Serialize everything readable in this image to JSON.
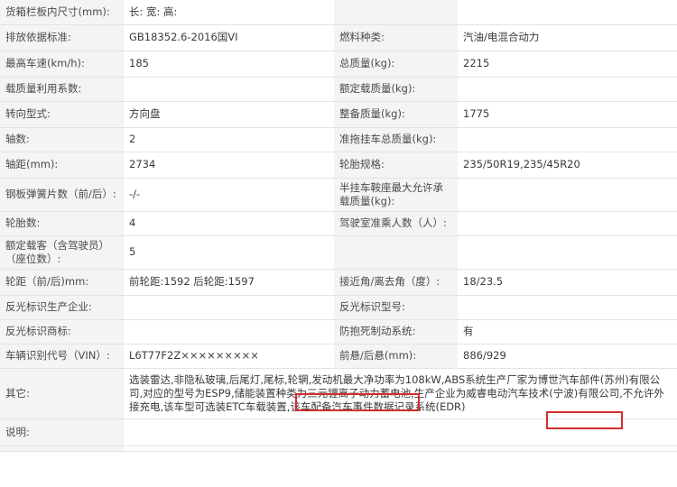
{
  "rows": [
    {
      "l1": "货箱栏板内尺寸(mm):",
      "v1": "长:  宽:  高:",
      "l2": "",
      "v2": ""
    },
    {
      "l1": "排放依据标准:",
      "v1": "GB18352.6-2016国VI",
      "l2": "燃料种类:",
      "v2": "汽油/电混合动力"
    },
    {
      "l1": "最高车速(km/h):",
      "v1": "185",
      "l2": "总质量(kg):",
      "v2": "2215"
    },
    {
      "l1": "载质量利用系数:",
      "v1": "",
      "l2": "额定载质量(kg):",
      "v2": ""
    },
    {
      "l1": "转向型式:",
      "v1": "方向盘",
      "l2": "整备质量(kg):",
      "v2": "1775"
    },
    {
      "l1": "轴数:",
      "v1": "2",
      "l2": "准拖挂车总质量(kg):",
      "v2": ""
    },
    {
      "l1": "轴距(mm):",
      "v1": "2734",
      "l2": "轮胎规格:",
      "v2": "235/50R19,235/45R20"
    },
    {
      "l1": "钢板弹簧片数（前/后）:",
      "v1": "-/-",
      "l2": "半挂车鞍座最大允许承载质量(kg):",
      "v2": ""
    },
    {
      "l1": "轮胎数:",
      "v1": "4",
      "l2": "驾驶室准乘人数（人）:",
      "v2": ""
    },
    {
      "l1": "额定载客（含驾驶员）（座位数）:",
      "v1": "5",
      "l2": "",
      "v2": ""
    },
    {
      "l1": "轮距（前/后)mm:",
      "v1": "前轮距:1592 后轮距:1597",
      "l2": "接近角/离去角（度）:",
      "v2": "18/23.5"
    },
    {
      "l1": "反光标识生产企业:",
      "v1": "",
      "l2": "反光标识型号:",
      "v2": ""
    },
    {
      "l1": "反光标识商标:",
      "v1": "",
      "l2": "防抱死制动系统:",
      "v2": "有"
    },
    {
      "l1": "车辆识别代号（VIN）:",
      "v1": "L6T77F2Z×××××××××",
      "l2": "前悬/后悬(mm):",
      "v2": "886/929"
    }
  ],
  "other": {
    "label": "其它:",
    "text": "选装雷达,非隐私玻璃,后尾灯,尾标,轮辋,发动机最大净功率为108kW,ABS系统生产厂家为博世汽车部件(苏州)有限公司,对应的型号为ESP9,储能装置种类为三元锂离子动力蓄电池,生产企业为威睿电动汽车技术(宁波)有限公司,不允许外接充电,该车型可选装ETC车载装置,该车配备汽车事件数据记录系统(EDR)"
  },
  "note": {
    "label": "说明:",
    "text": ""
  },
  "highlight_color": "#d22d2d"
}
